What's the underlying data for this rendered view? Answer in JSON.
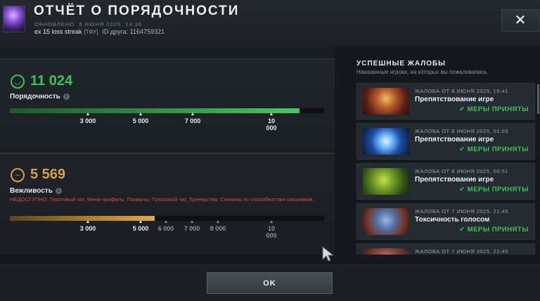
{
  "header": {
    "title": "ОТЧЁТ О ПОРЯДОЧНОСТИ",
    "updated": "ОБНОВЛЕНО: 9 ИЮНЯ 2025, 14:36",
    "player_name": "ex 15 loss streak",
    "player_tag": "[ТФУ]",
    "friend_id": "ID друга: 1164759321",
    "close_label": "✕"
  },
  "conduct": {
    "score": "11 024",
    "label": "Порядочность",
    "fill_fraction": 0.92,
    "color": "#3cc45a",
    "ticks": [
      "3 000",
      "5 000",
      "7 000",
      "10\n000"
    ]
  },
  "politeness": {
    "score": "5 569",
    "label": "Вежливость",
    "unavailable": "НЕДОСТУПНО: Текстовый чат, Мини-профиль, Похвалы, Голосовой чат, Тренерство, Сигналы по способностям союзников.",
    "fill_fraction": 0.46,
    "color": "#d7a13f",
    "ticks": [
      "3 000",
      "5 000",
      "6 000",
      "7 000",
      "8 000",
      "10\n000"
    ]
  },
  "reports_panel": {
    "title": "УСПЕШНЫЕ ЖАЛОБЫ",
    "subtitle": "Наказанные игроки, на которых вы пожаловались.",
    "items": [
      {
        "date": "ЖАЛОБА ОТ 8 ИЮНЯ 2025, 19:41",
        "reason": "Препятствование игре",
        "status": "✔ МЕРЫ ПРИНЯТЫ",
        "hero_icon": "hero-portrait-icon"
      },
      {
        "date": "ЖАЛОБА ОТ 8 ИЮНЯ 2025, 01:03",
        "reason": "Препятствование игре",
        "status": "✔ МЕРЫ ПРИНЯТЫ",
        "hero_icon": "hero-portrait-icon"
      },
      {
        "date": "ЖАЛОБА ОТ 8 ИЮНЯ 2025, 00:51",
        "reason": "Препятствование игре",
        "status": "✔ МЕРЫ ПРИНЯТЫ",
        "hero_icon": "hero-portrait-icon"
      },
      {
        "date": "ЖАЛОБА ОТ 7 ИЮНЯ 2025, 21:45",
        "reason": "Токсичность голосом",
        "status": "✔ МЕРЫ ПРИНЯТЫ",
        "hero_icon": "hero-portrait-icon"
      },
      {
        "date": "ЖАЛОБА ОТ 7 ИЮНЯ 2025, 21:45",
        "reason": "",
        "status": "",
        "hero_icon": "hero-portrait-icon"
      }
    ]
  },
  "footer": {
    "ok_label": "OK"
  }
}
